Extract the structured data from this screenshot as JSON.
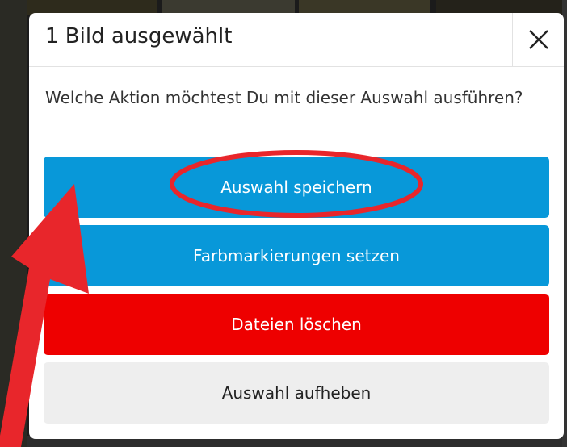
{
  "dialog": {
    "title": "1 Bild ausgewählt",
    "question": "Welche Aktion möchtest Du mit dieser Auswahl ausführen?",
    "close_icon": "close-icon"
  },
  "actions": {
    "save_selection": "Auswahl speichern",
    "set_color_markers": "Farbmarkierungen setzen",
    "delete_files": "Dateien löschen",
    "clear_selection": "Auswahl aufheben"
  },
  "colors": {
    "primary_button": "#0898d9",
    "danger_button": "#ee0000",
    "neutral_button": "#eeeeee",
    "annotation": "#e8262b"
  },
  "annotation": {
    "arrow_icon": "red-arrow-annotation",
    "ellipse_icon": "red-ellipse-annotation"
  }
}
